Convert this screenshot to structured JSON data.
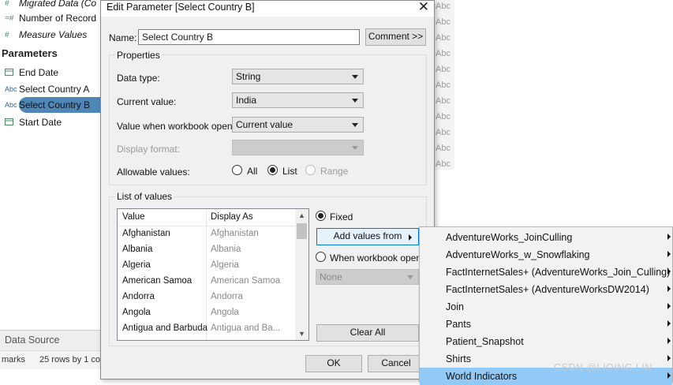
{
  "background": {
    "fields": [
      {
        "icon": "#",
        "label": "Migrated Data (Co",
        "italic": true
      },
      {
        "icon": "=#",
        "label": "Number of Record",
        "italic": false
      },
      {
        "icon": "#",
        "label": "Measure Values",
        "italic": true
      }
    ],
    "parameters_heading": "Parameters",
    "parameters": [
      {
        "icon": "calendar",
        "label": "End Date"
      },
      {
        "icon": "Abc",
        "label": "Select Country A"
      },
      {
        "icon": "Abc",
        "label": "Select Country B"
      },
      {
        "icon": "calendar",
        "label": "Start Date"
      }
    ],
    "data_source_tab": "Data Source",
    "status_marks": "marks",
    "status_rows": "25 rows by 1 co",
    "abc_column": [
      "Abc",
      "Abc",
      "Abc",
      "Abc",
      "Abc",
      "Abc",
      "Abc",
      "Abc",
      "Abc",
      "Abc",
      "Abc"
    ]
  },
  "dialog": {
    "title": "Edit Parameter [Select Country B]",
    "close_glyph": "✕",
    "name_label": "Name:",
    "name_value": "Select Country B",
    "comment_button": "Comment >>",
    "properties": {
      "title": "Properties",
      "data_type_label": "Data type:",
      "data_type_value": "String",
      "current_value_label": "Current value:",
      "current_value": "India",
      "workbook_opens_label": "Value when workbook opens:",
      "workbook_opens_value": "Current value",
      "display_format_label": "Display format:",
      "display_format_value": "",
      "allowable_label": "Allowable values:",
      "allowable_options": [
        "All",
        "List",
        "Range"
      ],
      "allowable_selected": "List"
    },
    "list_of_values": {
      "title": "List of values",
      "columns": [
        "Value",
        "Display As"
      ],
      "rows": [
        {
          "value": "Afghanistan",
          "display": "Afghanistan"
        },
        {
          "value": "Albania",
          "display": "Albania"
        },
        {
          "value": "Algeria",
          "display": "Algeria"
        },
        {
          "value": "American Samoa",
          "display": "American Samoa"
        },
        {
          "value": "Andorra",
          "display": "Andorra"
        },
        {
          "value": "Angola",
          "display": "Angola"
        },
        {
          "value": "Antigua and Barbuda",
          "display": "Antigua and Ba..."
        }
      ],
      "fixed_label": "Fixed",
      "add_values_button": "Add values from",
      "when_opens_label": "When workbook opens",
      "when_opens_combo": "None",
      "clear_all_button": "Clear All"
    },
    "ok_button": "OK",
    "cancel_button": "Cancel"
  },
  "menu": {
    "items": [
      "AdventureWorks_JoinCulling",
      "AdventureWorks_w_Snowflaking",
      "FactInternetSales+ (AdventureWorks_Join_Culling)",
      "FactInternetSales+ (AdventureWorksDW2014)",
      "Join",
      "Pants",
      "Patient_Snapshot",
      "Shirts",
      "World Indicators"
    ],
    "selected": "World Indicators"
  },
  "watermark": "CSDN @LIQING LIN",
  "colors": {
    "selection": "#4f86b8",
    "menu_highlight": "#91c9f7",
    "focus_border": "#0078d7"
  }
}
